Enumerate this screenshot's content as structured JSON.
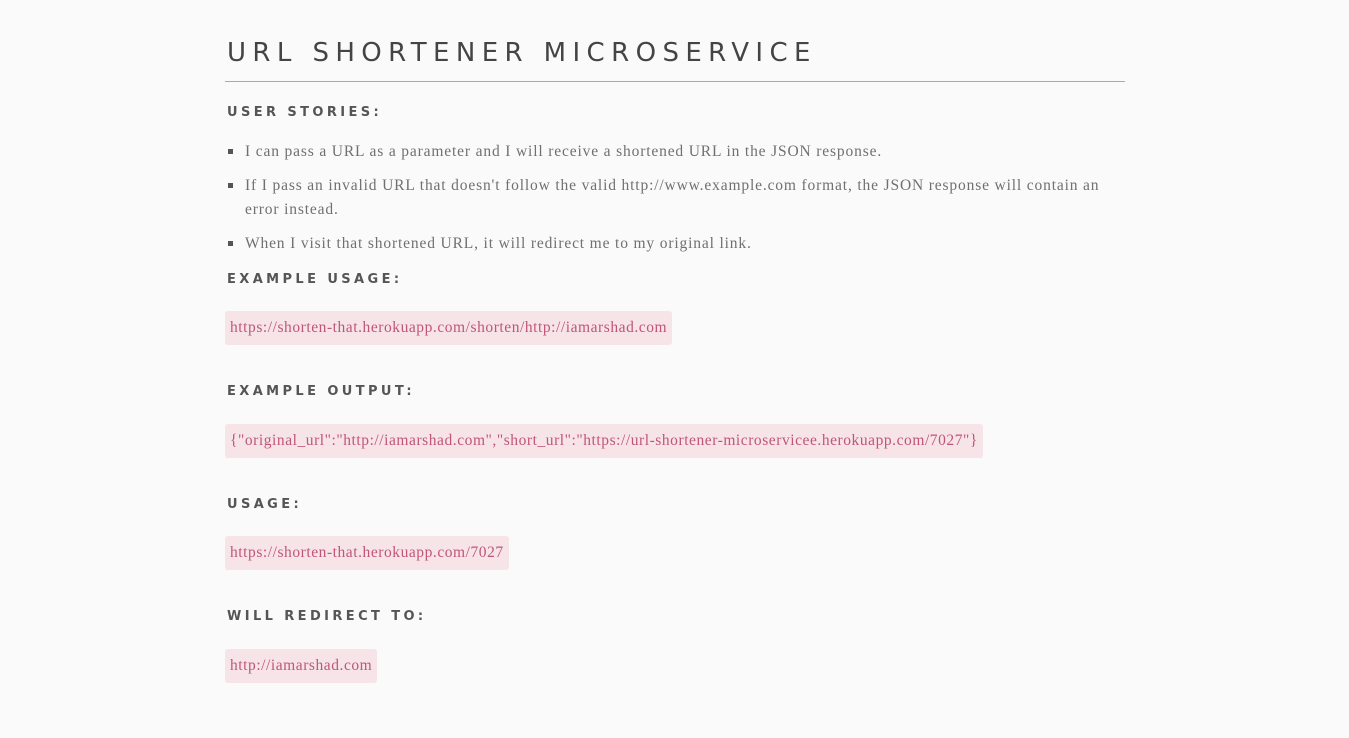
{
  "page": {
    "title": "URL SHORTENER MICROSERVICE"
  },
  "user_stories": {
    "heading": "USER STORIES:",
    "items": [
      "I can pass a URL as a parameter and I will receive a shortened URL in the JSON response.",
      "If I pass an invalid URL that doesn't follow the valid http://www.example.com format, the JSON response will contain an error instead.",
      "When I visit that shortened URL, it will redirect me to my original link."
    ]
  },
  "example_usage": {
    "heading": "EXAMPLE USAGE:",
    "code": "https://shorten-that.herokuapp.com/shorten/http://iamarshad.com"
  },
  "example_output": {
    "heading": "EXAMPLE OUTPUT:",
    "code": "{\"original_url\":\"http://iamarshad.com\",\"short_url\":\"https://url-shortener-microservicee.herokuapp.com/7027\"}"
  },
  "usage": {
    "heading": "USAGE:",
    "code": "https://shorten-that.herokuapp.com/7027"
  },
  "redirect": {
    "heading": "WILL REDIRECT TO:",
    "code": "http://iamarshad.com"
  },
  "colors": {
    "background": "#fafafa",
    "code_background": "#f7e4e8",
    "code_text": "#c0557a",
    "body_text": "#707070"
  }
}
